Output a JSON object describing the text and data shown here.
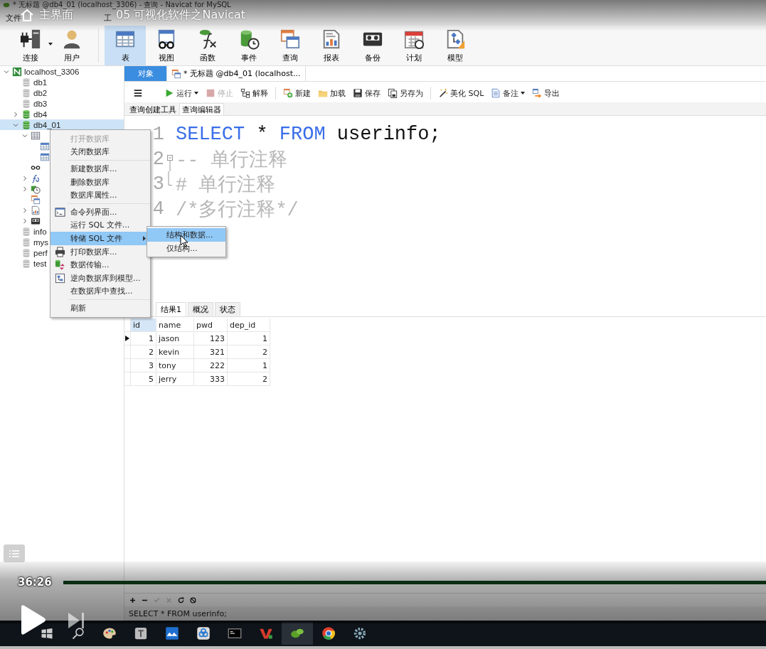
{
  "window": {
    "title": "* 无标题 @db4_01 (localhost_3306) - 查询 - Navicat for MySQL"
  },
  "video_overlay": {
    "home_label": "主界面",
    "video_title": "05 可视化软件之Navicat",
    "time": "36:26"
  },
  "menu_bar": [
    "文件",
    "工"
  ],
  "progress": {
    "level": 1
  },
  "main_toolbar": [
    {
      "label": "连接",
      "kind": "connection",
      "selected": false,
      "dropdown": true
    },
    {
      "label": "用户",
      "kind": "user",
      "selected": false,
      "dropdown": false
    },
    {
      "label": "表",
      "kind": "table",
      "selected": true,
      "dropdown": false
    },
    {
      "label": "视图",
      "kind": "view",
      "selected": false,
      "dropdown": false
    },
    {
      "label": "函数",
      "kind": "function",
      "selected": false,
      "dropdown": false
    },
    {
      "label": "事件",
      "kind": "event",
      "selected": false,
      "dropdown": false
    },
    {
      "label": "查询",
      "kind": "query",
      "selected": false,
      "dropdown": false
    },
    {
      "label": "报表",
      "kind": "report",
      "selected": false,
      "dropdown": false
    },
    {
      "label": "备份",
      "kind": "backup",
      "selected": false,
      "dropdown": false
    },
    {
      "label": "计划",
      "kind": "schedule",
      "selected": false,
      "dropdown": false
    },
    {
      "label": "模型",
      "kind": "model",
      "selected": false,
      "dropdown": false
    }
  ],
  "sidebar": {
    "tree": [
      {
        "label": "localhost_3306",
        "kind": "connection",
        "expanded": true,
        "selected": false,
        "children": [
          {
            "label": "db1",
            "kind": "db-closed",
            "selected": false
          },
          {
            "label": "db2",
            "kind": "db-closed",
            "selected": false
          },
          {
            "label": "db3",
            "kind": "db-closed",
            "selected": false
          },
          {
            "label": "db4",
            "kind": "db-open",
            "expanded": false,
            "selected": false
          },
          {
            "label": "db4_01",
            "kind": "db-open",
            "expanded": true,
            "selected": true,
            "children": [
              {
                "kind": "tables",
                "expanded": true,
                "selected": false,
                "children": [
                  {
                    "kind": "table",
                    "selected": false
                  },
                  {
                    "kind": "table",
                    "selected": false
                  }
                ]
              },
              {
                "kind": "views",
                "selected": false
              },
              {
                "kind": "functions",
                "expanded": false,
                "selected": false
              },
              {
                "kind": "events",
                "expanded": false,
                "selected": false
              },
              {
                "kind": "queries",
                "selected": false
              },
              {
                "kind": "reports",
                "expanded": false,
                "selected": false
              },
              {
                "kind": "backups",
                "expanded": false,
                "selected": false
              }
            ]
          },
          {
            "label": "info",
            "kind": "db-closed",
            "selected": false
          },
          {
            "label": "mys",
            "kind": "db-closed",
            "selected": false
          },
          {
            "label": "perf",
            "kind": "db-closed",
            "selected": false
          },
          {
            "label": "test",
            "kind": "db-closed",
            "selected": false
          }
        ]
      }
    ]
  },
  "tabs": [
    {
      "label": "对象",
      "kind": "object",
      "selected": true
    },
    {
      "label": "* 无标题 @db4_01 (localhost...",
      "kind": "query",
      "selected": false
    }
  ],
  "query_toolbar": [
    {
      "kind": "menu"
    },
    {
      "kind": "run",
      "label": "运行",
      "disabled": false,
      "dropdown": true
    },
    {
      "kind": "stop",
      "label": "停止",
      "disabled": true
    },
    {
      "kind": "explain",
      "label": "解释",
      "disabled": false
    },
    {
      "kind": "new",
      "label": "新建",
      "disabled": false
    },
    {
      "kind": "load",
      "label": "加载",
      "disabled": false
    },
    {
      "kind": "save",
      "label": "保存",
      "disabled": false
    },
    {
      "kind": "saveas",
      "label": "另存为",
      "disabled": false
    },
    {
      "kind": "beautify",
      "label": "美化 SQL",
      "disabled": false
    },
    {
      "kind": "note",
      "label": "备注",
      "disabled": false,
      "dropdown": true
    },
    {
      "kind": "export",
      "label": "导出",
      "disabled": false
    }
  ],
  "editor_tabs": [
    {
      "label": "查询创建工具",
      "selected": false
    },
    {
      "label": "查询编辑器",
      "selected": true
    }
  ],
  "editor": {
    "lines": [
      {
        "number": "1",
        "fold_start": false,
        "fold_end": false,
        "tokens": [
          {
            "text": "SELECT",
            "kind": "keyword"
          },
          {
            "text": " * ",
            "kind": "plain"
          },
          {
            "text": "FROM",
            "kind": "keyword"
          },
          {
            "text": " userinfo;",
            "kind": "plain"
          }
        ]
      },
      {
        "number": "2",
        "fold_start": true,
        "fold_end": false,
        "tokens": [
          {
            "text": "-- 单行注释",
            "kind": "comment"
          }
        ]
      },
      {
        "number": "3",
        "fold_start": false,
        "fold_end": true,
        "tokens": [
          {
            "text": "# 单行注释",
            "kind": "comment"
          }
        ]
      },
      {
        "number": "4",
        "fold_start": false,
        "fold_end": false,
        "tokens": [
          {
            "text": "/*多行注释*/",
            "kind": "comment"
          }
        ]
      }
    ]
  },
  "result_tabs": [
    {
      "label": "结果1",
      "selected": true
    },
    {
      "label": "概况",
      "selected": false
    },
    {
      "label": "状态",
      "selected": false
    }
  ],
  "result_table": {
    "columns": [
      "id",
      "name",
      "pwd",
      "dep_id"
    ],
    "rows": [
      {
        "cells": [
          "1",
          "jason",
          "123",
          "1"
        ],
        "selected": true
      },
      {
        "cells": [
          "2",
          "kevin",
          "321",
          "2"
        ],
        "selected": false
      },
      {
        "cells": [
          "3",
          "tony",
          "222",
          "1"
        ],
        "selected": false
      },
      {
        "cells": [
          "5",
          "jerry",
          "333",
          "2"
        ],
        "selected": false
      }
    ]
  },
  "result_toolbar": [
    {
      "kind": "add",
      "disabled": false
    },
    {
      "kind": "remove",
      "disabled": false
    },
    {
      "kind": "apply",
      "disabled": true
    },
    {
      "kind": "discard",
      "disabled": true
    },
    {
      "kind": "refresh",
      "disabled": false
    },
    {
      "kind": "stop",
      "disabled": false
    }
  ],
  "status_bar": {
    "text": "SELECT * FROM userinfo;"
  },
  "context_menu": {
    "items": [
      {
        "kind": "item",
        "label": "打开数据库",
        "disabled": true,
        "selected": false
      },
      {
        "kind": "item",
        "label": "关闭数据库",
        "disabled": false,
        "selected": false
      },
      {
        "kind": "separator"
      },
      {
        "kind": "item",
        "label": "新建数据库...",
        "disabled": false,
        "selected": false
      },
      {
        "kind": "item",
        "label": "删除数据库",
        "disabled": false,
        "selected": false
      },
      {
        "kind": "item",
        "label": "数据库属性...",
        "disabled": false,
        "selected": false
      },
      {
        "kind": "separator"
      },
      {
        "kind": "terminal",
        "label": "命令列界面...",
        "disabled": false,
        "selected": false
      },
      {
        "kind": "item",
        "label": "运行 SQL 文件...",
        "disabled": false,
        "selected": false
      },
      {
        "kind": "item",
        "label": "转储 SQL 文件",
        "disabled": false,
        "selected": true,
        "submenu": true
      },
      {
        "kind": "printer",
        "label": "打印数据库...",
        "disabled": false,
        "selected": false
      },
      {
        "kind": "transfer",
        "label": "数据传输...",
        "disabled": false,
        "selected": false
      },
      {
        "kind": "model",
        "label": "逆向数据库到模型...",
        "disabled": false,
        "selected": false
      },
      {
        "kind": "item",
        "label": "在数据库中查找...",
        "disabled": false,
        "selected": false
      },
      {
        "kind": "separator"
      },
      {
        "kind": "item",
        "label": "刷新",
        "disabled": false,
        "selected": false
      }
    ]
  },
  "submenu": {
    "items": [
      {
        "label": "结构和数据...",
        "selected": true
      },
      {
        "label": "仅结构...",
        "selected": false
      }
    ]
  },
  "taskbar": [
    {
      "kind": "start",
      "selected": false
    },
    {
      "kind": "search",
      "selected": false
    },
    {
      "kind": "paint",
      "selected": false
    },
    {
      "kind": "text",
      "selected": false
    },
    {
      "kind": "waves",
      "selected": false
    },
    {
      "kind": "cloud",
      "selected": false
    },
    {
      "kind": "terminal",
      "selected": false
    },
    {
      "kind": "wps",
      "selected": false
    },
    {
      "kind": "leaf",
      "selected": true
    },
    {
      "kind": "chrome",
      "selected": false
    },
    {
      "kind": "tool",
      "selected": false
    }
  ]
}
